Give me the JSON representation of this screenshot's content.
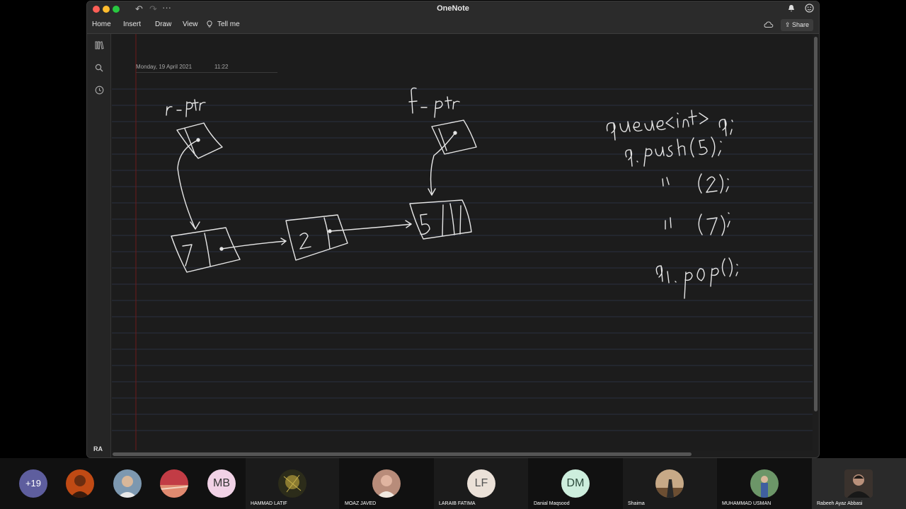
{
  "window": {
    "title": "OneNote",
    "ribbon_tabs": [
      "Home",
      "Insert",
      "Draw",
      "View"
    ],
    "tell_me": "Tell me",
    "share": "Share",
    "user_initials": "RA"
  },
  "page": {
    "date": "Monday, 19 April 2021",
    "time": "11:22"
  },
  "participants": {
    "overflow": "+19",
    "tiles": [
      {
        "initials": "",
        "name": "",
        "color": "#d4571d",
        "photo": true
      },
      {
        "initials": "",
        "name": "",
        "color": "#8aa0b5",
        "photo": true
      },
      {
        "initials": "",
        "name": "",
        "color": "#c9505a",
        "photo": true
      },
      {
        "initials": "MB",
        "name": "",
        "color": "#f1d2e6",
        "photo": false
      },
      {
        "initials": "",
        "name": "HAMMAD LATIF",
        "color": "#3b3a20",
        "photo": true
      },
      {
        "initials": "",
        "name": "MOAZ JAVED",
        "color": "#c98f7a",
        "photo": true
      },
      {
        "initials": "LF",
        "name": "LARAIB FATIMA",
        "color": "#ebe1d8",
        "photo": false
      },
      {
        "initials": "DM",
        "name": "Danial Maqsood",
        "color": "#cdeedd",
        "photo": false
      },
      {
        "initials": "",
        "name": "Shaima",
        "color": "#b99a7a",
        "photo": true
      },
      {
        "initials": "",
        "name": "MUHAMMAD USMAN",
        "color": "#7aa076",
        "photo": true
      },
      {
        "initials": "",
        "name": "Rabeeh Ayaz Abbasi",
        "color": "#6e5a4e",
        "photo": true
      }
    ]
  },
  "icons": {
    "undo": "undo-icon",
    "redo": "redo-icon",
    "more": "more-icon",
    "lightbulb": "lightbulb-icon",
    "notebooks": "notebooks-icon",
    "search": "search-icon",
    "recent": "clock-icon",
    "bell": "bell-icon",
    "emoji": "smiley-icon",
    "sync": "sync-cloud-icon"
  },
  "colors": {
    "accent_red_margin": "#7a1b1b",
    "ink": "#e6e6e6"
  }
}
